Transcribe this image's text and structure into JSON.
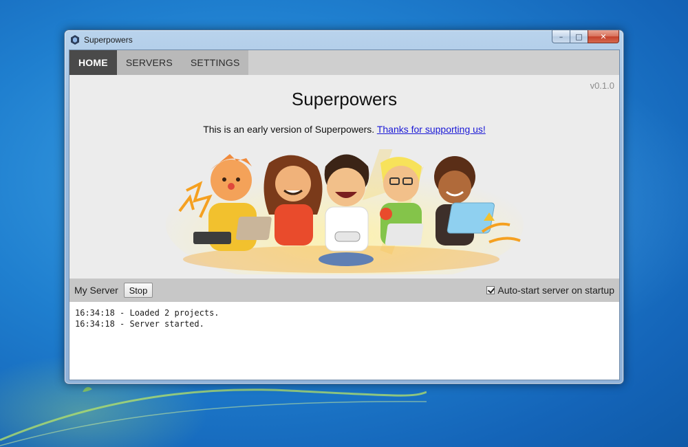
{
  "window": {
    "title": "Superpowers",
    "controls": {
      "minimize_icon": "minimize-icon",
      "maximize_icon": "maximize-icon",
      "close_icon": "close-icon"
    }
  },
  "tabs": [
    {
      "label": "HOME",
      "active": true
    },
    {
      "label": "SERVERS",
      "active": false
    },
    {
      "label": "SETTINGS",
      "active": false
    }
  ],
  "home": {
    "version": "v0.1.0",
    "title": "Superpowers",
    "intro_text": "This is an early version of Superpowers. ",
    "intro_link": "Thanks for supporting us!",
    "illustration": "five-characters-illustration"
  },
  "server": {
    "name": "My Server",
    "stop_label": "Stop",
    "autostart_label": "Auto-start server on startup",
    "autostart_checked": true
  },
  "log": [
    "16:34:18 - Loaded 2 projects.",
    "16:34:18 - Server started."
  ],
  "colors": {
    "active_tab": "#4a4a4a",
    "tab_bar": "#cfcfcf",
    "link": "#1a18d6",
    "desktop": "#1f7fcf"
  }
}
